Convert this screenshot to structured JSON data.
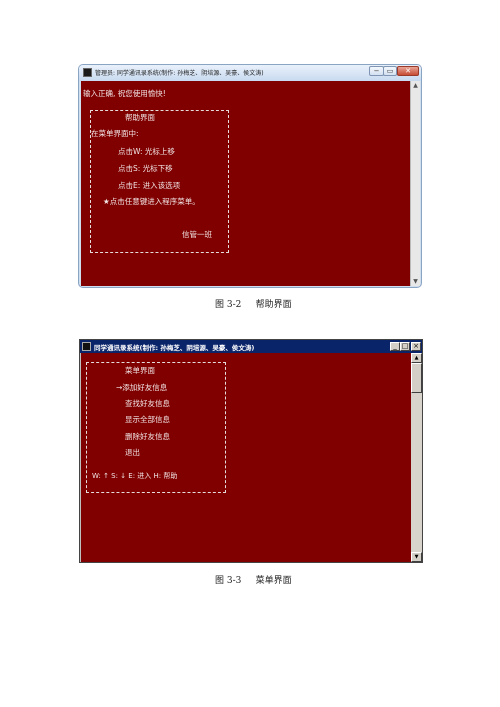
{
  "figure1": {
    "window_title": "管理员:  同学通讯录系统(制作: 孙梅芝、阴培源、吴豪、侯文涛)",
    "controls": {
      "minimize": "−",
      "maximize": "▭",
      "close": "✕"
    },
    "console_lines": {
      "status": "输入正确, 祝您使用愉快!",
      "help_title": "帮助界面",
      "intro": "在菜单界面中:",
      "line_w": "点击W: 光标上移",
      "line_s": "点击S: 光标下移",
      "line_e": "点击E: 进入该选项",
      "line_any": "★点击任意键进入程序菜单。",
      "class_name": "信管一班"
    },
    "caption": {
      "number": "图 3-2",
      "text": "帮助界面"
    }
  },
  "figure2": {
    "window_title": "同学通讯录系统(制作: 孙梅芝、阴培源、吴豪、侯文涛)",
    "controls": {
      "minimize": "_",
      "maximize": "□",
      "close": "×"
    },
    "menu_title": "菜单界面",
    "menu_items": [
      "→添加好友信息",
      "查找好友信息",
      "显示全部信息",
      "删除好友信息",
      "退出"
    ],
    "key_hint": "W: ↑  S: ↓  E: 进入  H: 帮助",
    "caption": {
      "number": "图 3-3",
      "text": "菜单界面"
    }
  },
  "colors": {
    "console_bg": "#800000",
    "console_text": "#f2e6e6",
    "classic_title": "#0a246a"
  }
}
